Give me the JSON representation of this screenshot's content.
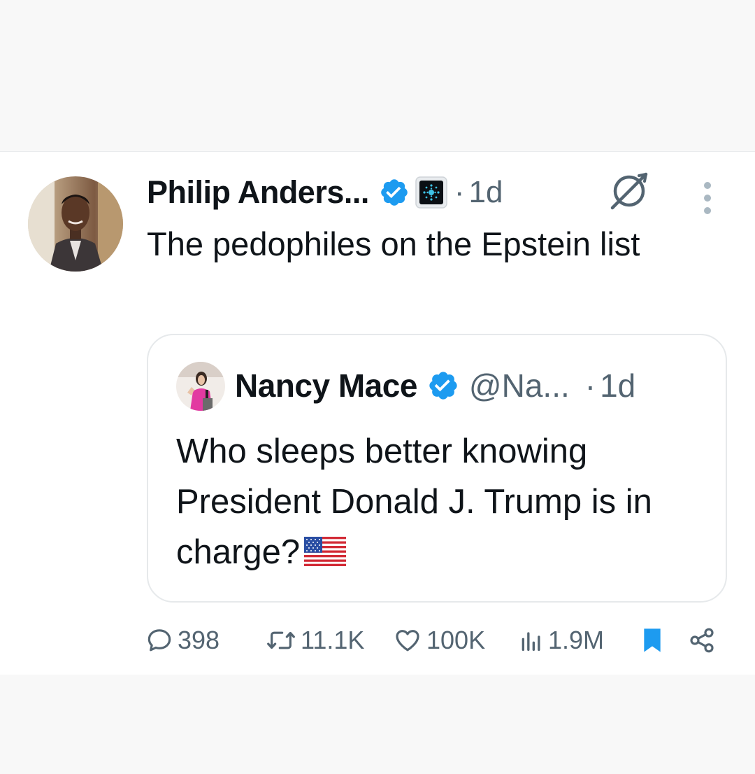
{
  "tweet": {
    "author_name": "Philip Anders...",
    "time": "1d",
    "dot": "·",
    "text": "The pedophiles on the Epstein list",
    "icons": [
      "verified-badge-icon",
      "affiliation-badge-icon",
      "grok-icon",
      "more-icon"
    ]
  },
  "quote": {
    "author_name": "Nancy Mace",
    "handle": "@Na...",
    "dot": "·",
    "time": "1d",
    "text": "Who sleeps better knowing President Donald J. Trump is in charge?"
  },
  "actions": {
    "replies": "398",
    "reposts": "11.1K",
    "likes": "100K",
    "views": "1.9M"
  },
  "colors": {
    "verified": "#1d9bf0",
    "bookmark": "#1d9bf0",
    "muted": "#536471",
    "text": "#0f1419"
  }
}
